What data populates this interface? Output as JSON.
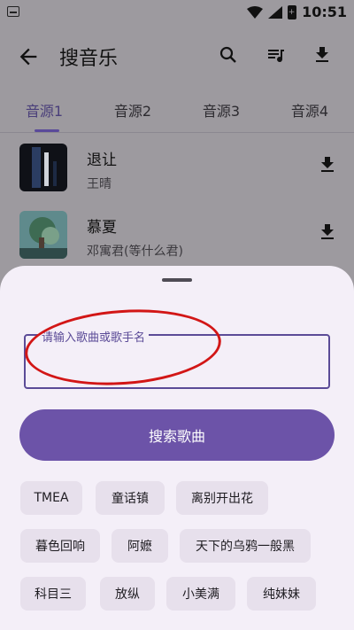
{
  "status_bar": {
    "time": "10:51",
    "battery_glyph": "+"
  },
  "app_bar": {
    "title": "搜音乐"
  },
  "tabs": [
    {
      "label": "音源1",
      "active": true
    },
    {
      "label": "音源2",
      "active": false
    },
    {
      "label": "音源3",
      "active": false
    },
    {
      "label": "音源4",
      "active": false
    }
  ],
  "songs": [
    {
      "title": "退让",
      "artist": "王晴"
    },
    {
      "title": "慕夏",
      "artist": "邓寓君(等什么君)"
    }
  ],
  "search_sheet": {
    "input_placeholder": "请输入歌曲或歌手名",
    "input_value": "",
    "search_button": "搜索歌曲",
    "hot_keywords": [
      "TMEA",
      "童话镇",
      "离别开出花",
      "暮色回响",
      "阿嬷",
      "天下的乌鸦一般黑",
      "科目三",
      "放纵",
      "小美满",
      "纯妹妹"
    ]
  },
  "colors": {
    "accent": "#6c53a8",
    "annotation": "#d21616"
  }
}
